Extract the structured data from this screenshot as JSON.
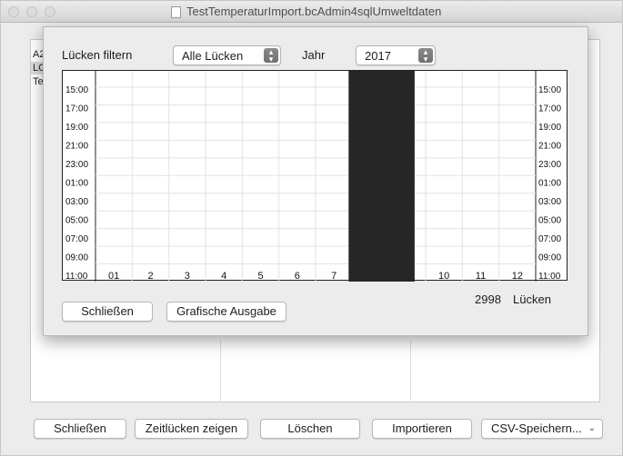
{
  "window": {
    "title": "TestTemperaturImport.bcAdmin4sqlUmweltdaten"
  },
  "background_list": {
    "rows": [
      "A2",
      "LC",
      "Te"
    ]
  },
  "sheet": {
    "filter_label": "Lücken filtern",
    "filter_value": "Alle Lücken",
    "year_label": "Jahr",
    "year_value": "2017",
    "gap_count": "2998",
    "gap_label": "Lücken",
    "close_button": "Schließen",
    "graphic_button": "Grafische Ausgabe"
  },
  "chart_data": {
    "type": "heatmap",
    "y_ticks_left": [
      "15:00",
      "17:00",
      "19:00",
      "21:00",
      "23:00",
      "01:00",
      "03:00",
      "05:00",
      "07:00",
      "09:00",
      "11:00"
    ],
    "y_ticks_right": [
      "15:00",
      "17:00",
      "19:00",
      "21:00",
      "23:00",
      "01:00",
      "03:00",
      "05:00",
      "07:00",
      "09:00",
      "11:00"
    ],
    "x_ticks": [
      "01",
      "2",
      "3",
      "4",
      "5",
      "6",
      "7",
      "10",
      "11",
      "12"
    ],
    "gap_blocks": [
      {
        "from_month": 7.9,
        "to_month": 9.7,
        "from_hour_index": 0,
        "to_hour_index": 24
      }
    ],
    "grid": true,
    "block_color": "#262626"
  },
  "bottom_bar": {
    "close": "Schließen",
    "show_gaps": "Zeitlücken zeigen",
    "delete": "Löschen",
    "import": "Importieren",
    "csv": "CSV-Speichern..."
  }
}
